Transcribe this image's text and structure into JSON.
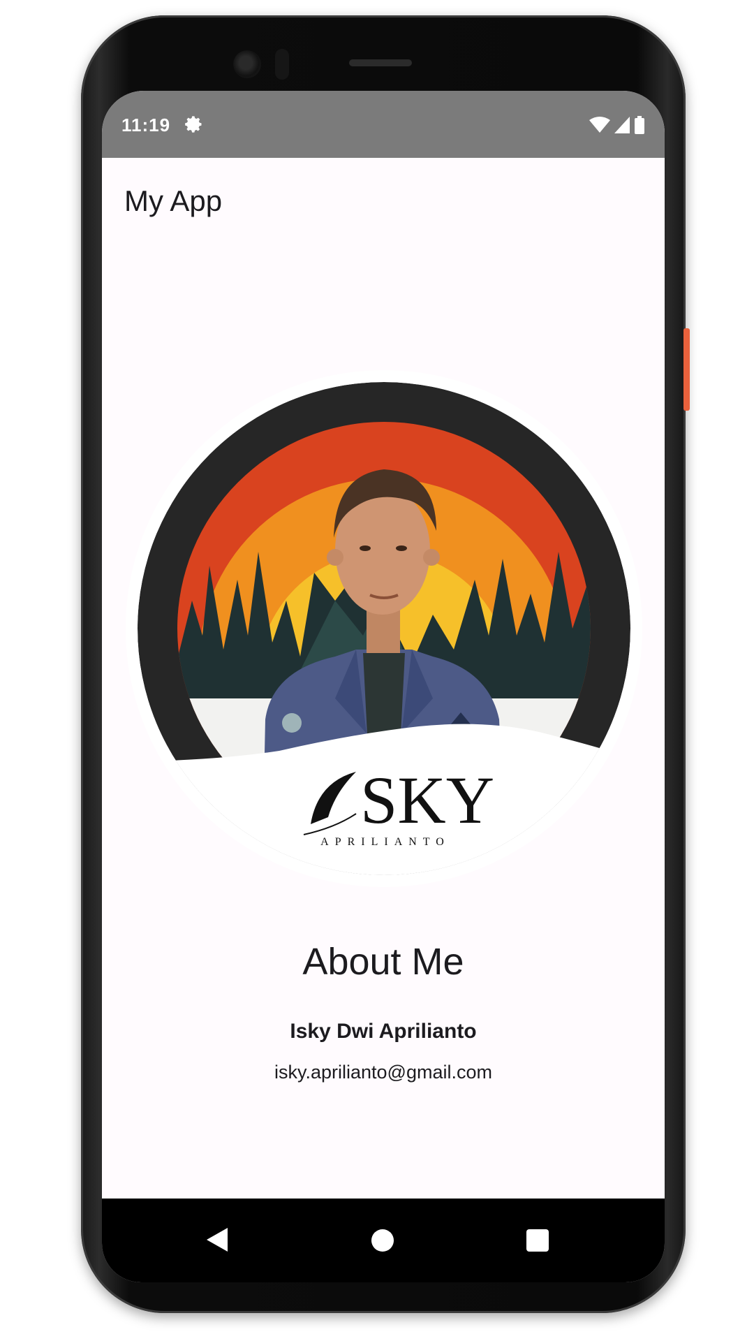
{
  "status_bar": {
    "time": "11:19",
    "left_icons": [
      "gear-icon"
    ],
    "right_icons": [
      "wifi-icon",
      "signal-icon",
      "battery-icon"
    ],
    "background": "#7b7b7b"
  },
  "app_bar": {
    "title": "My App"
  },
  "profile": {
    "avatar_logo_main": "SKY",
    "avatar_logo_sub": "APRILIANTO",
    "heading": "About Me",
    "name": "Isky Dwi Aprilianto",
    "email": "isky.aprilianto@gmail.com"
  },
  "navigation": {
    "items": [
      "back-icon",
      "home-icon",
      "recents-icon"
    ]
  },
  "colors": {
    "screen_background": "#fffbfe",
    "text": "#1c1b1f",
    "sunset_red": "#d9431f",
    "sunset_orange": "#f0901f",
    "sunset_yellow": "#f6c02a",
    "forest": "#1f3133",
    "jacket": "#4d5a87",
    "phone_accent": "#e8613c"
  }
}
